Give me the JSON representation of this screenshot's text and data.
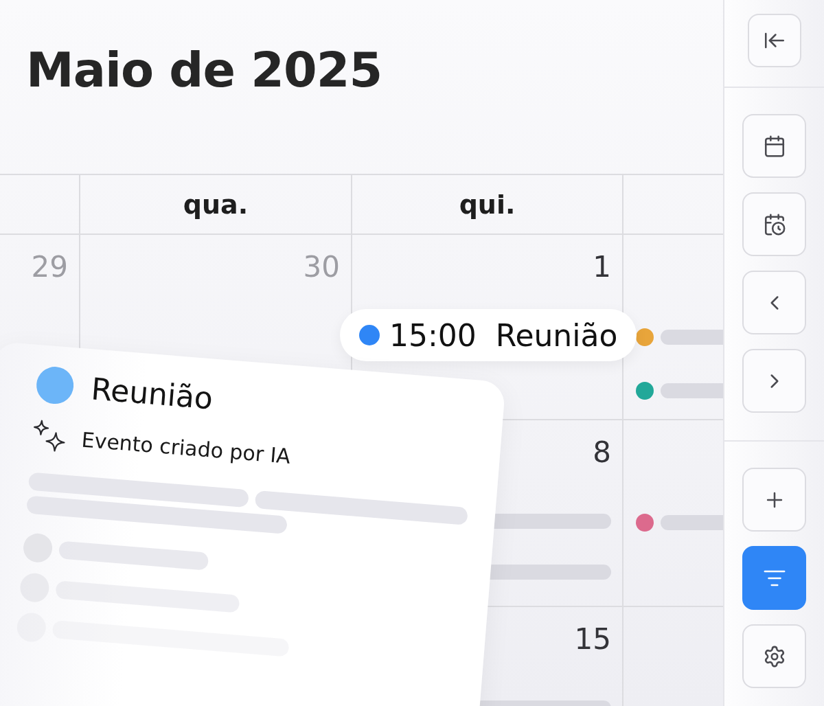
{
  "title": "Maio de 2025",
  "calendar": {
    "weekdays": [
      "qua.",
      "qui."
    ],
    "weeks": [
      {
        "cells": [
          {
            "day": "29",
            "muted": true
          },
          {
            "day": "30",
            "muted": true
          },
          {
            "day": "1",
            "muted": false
          },
          {
            "events": [
              {
                "kind": "dot",
                "color": "#e8a53b"
              },
              {
                "kind": "dot",
                "color": "#22a899"
              }
            ]
          }
        ]
      },
      {
        "cells": [
          {},
          {},
          {
            "day": "8",
            "muted": false,
            "events": [
              {
                "kind": "bar"
              },
              {
                "kind": "bar"
              }
            ]
          },
          {
            "events": [
              {
                "kind": "dot",
                "color": "#dc6a8d"
              }
            ]
          }
        ]
      },
      {
        "cells": [
          {},
          {},
          {
            "day": "15",
            "muted": false,
            "events": [
              {
                "kind": "bar"
              }
            ]
          },
          {}
        ]
      }
    ]
  },
  "event_pill": {
    "color": "#2f86f6",
    "time": "15:00",
    "title": "Reunião"
  },
  "event_card": {
    "color": "#6cb5f8",
    "title": "Reunião",
    "note": "Evento criado por IA"
  },
  "sidebar": {
    "sections": [
      {
        "buttons": [
          {
            "kind": "collapse",
            "selected": false
          }
        ]
      },
      {
        "buttons": [
          {
            "kind": "calendar",
            "selected": false
          },
          {
            "kind": "schedule",
            "selected": false
          },
          {
            "kind": "previous",
            "selected": false
          },
          {
            "kind": "next",
            "selected": false
          }
        ]
      },
      {
        "buttons": [
          {
            "kind": "add",
            "selected": false
          },
          {
            "kind": "filter",
            "selected": true
          },
          {
            "kind": "settings",
            "selected": false
          }
        ]
      }
    ]
  }
}
